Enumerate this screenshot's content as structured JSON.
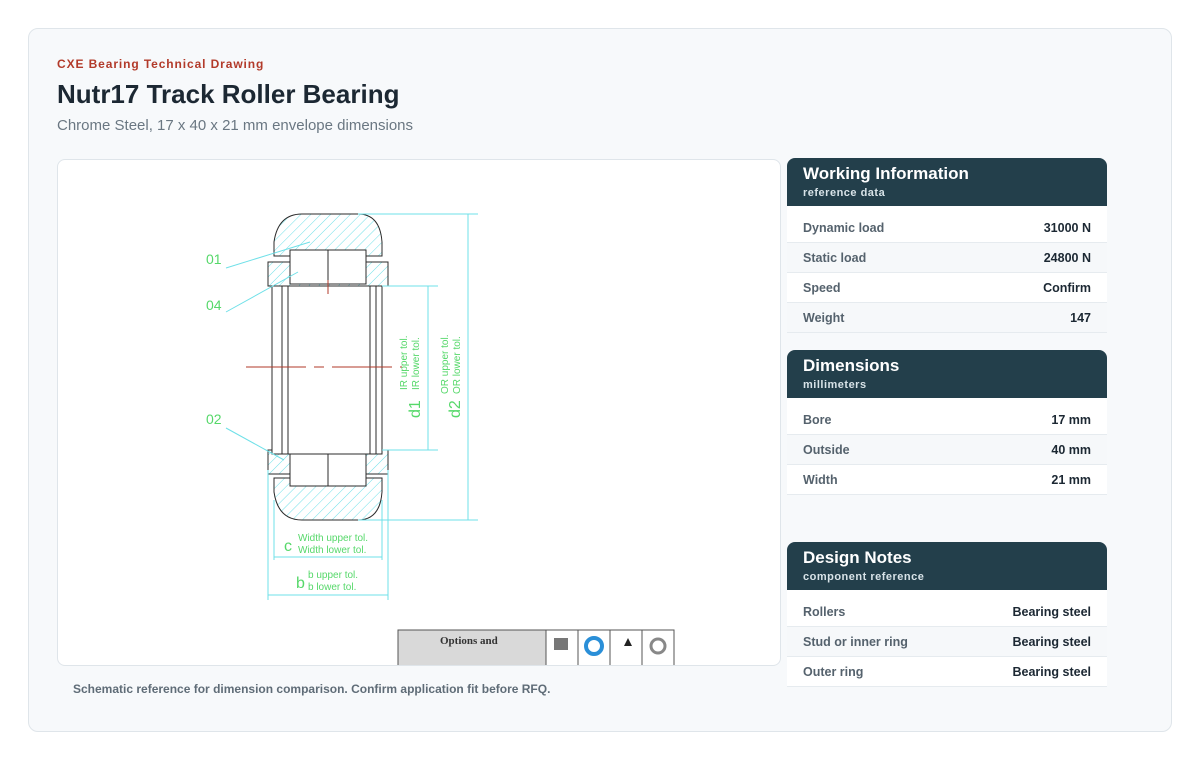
{
  "header": {
    "eyebrow": "CXE Bearing Technical Drawing",
    "title": "Nutr17 Track Roller Bearing",
    "subtitle": "Chrome Steel, 17 x 40 x 21 mm envelope dimensions"
  },
  "drawing": {
    "callouts": {
      "c01": "01",
      "c04": "04",
      "c02": "02"
    },
    "dims": {
      "d1": "d1",
      "d1_upper": "IR upper tol.",
      "d1_lower": "IR lower tol.",
      "d2": "d2",
      "d2_upper": "OR upper tol.",
      "d2_lower": "OR lower tol.",
      "c": "c",
      "c_upper": "Width upper tol.",
      "c_lower": "Width lower tol.",
      "b": "b",
      "b_upper": "b upper tol.",
      "b_lower": "b lower tol."
    },
    "options_label": "Options and",
    "caption": "Schematic reference for dimension comparison. Confirm application fit before RFQ.",
    "colors": {
      "dim": "#56d86a",
      "hatch": "#6fe0e8",
      "centerline": "#b23a2a"
    }
  },
  "working": {
    "title": "Working Information",
    "subtitle": "reference data",
    "rows": [
      {
        "k": "Dynamic load",
        "v": "31000 N"
      },
      {
        "k": "Static load",
        "v": "24800 N"
      },
      {
        "k": "Speed",
        "v": "Confirm"
      },
      {
        "k": "Weight",
        "v": "147"
      }
    ]
  },
  "dimensions": {
    "title": "Dimensions",
    "subtitle": "millimeters",
    "rows": [
      {
        "k": "Bore",
        "v": "17 mm"
      },
      {
        "k": "Outside",
        "v": "40 mm"
      },
      {
        "k": "Width",
        "v": "21 mm"
      }
    ]
  },
  "notes": {
    "title": "Design Notes",
    "subtitle": "component reference",
    "rows": [
      {
        "k": "Rollers",
        "v": "Bearing steel"
      },
      {
        "k": "Stud or inner ring",
        "v": "Bearing steel"
      },
      {
        "k": "Outer ring",
        "v": "Bearing steel"
      }
    ]
  }
}
